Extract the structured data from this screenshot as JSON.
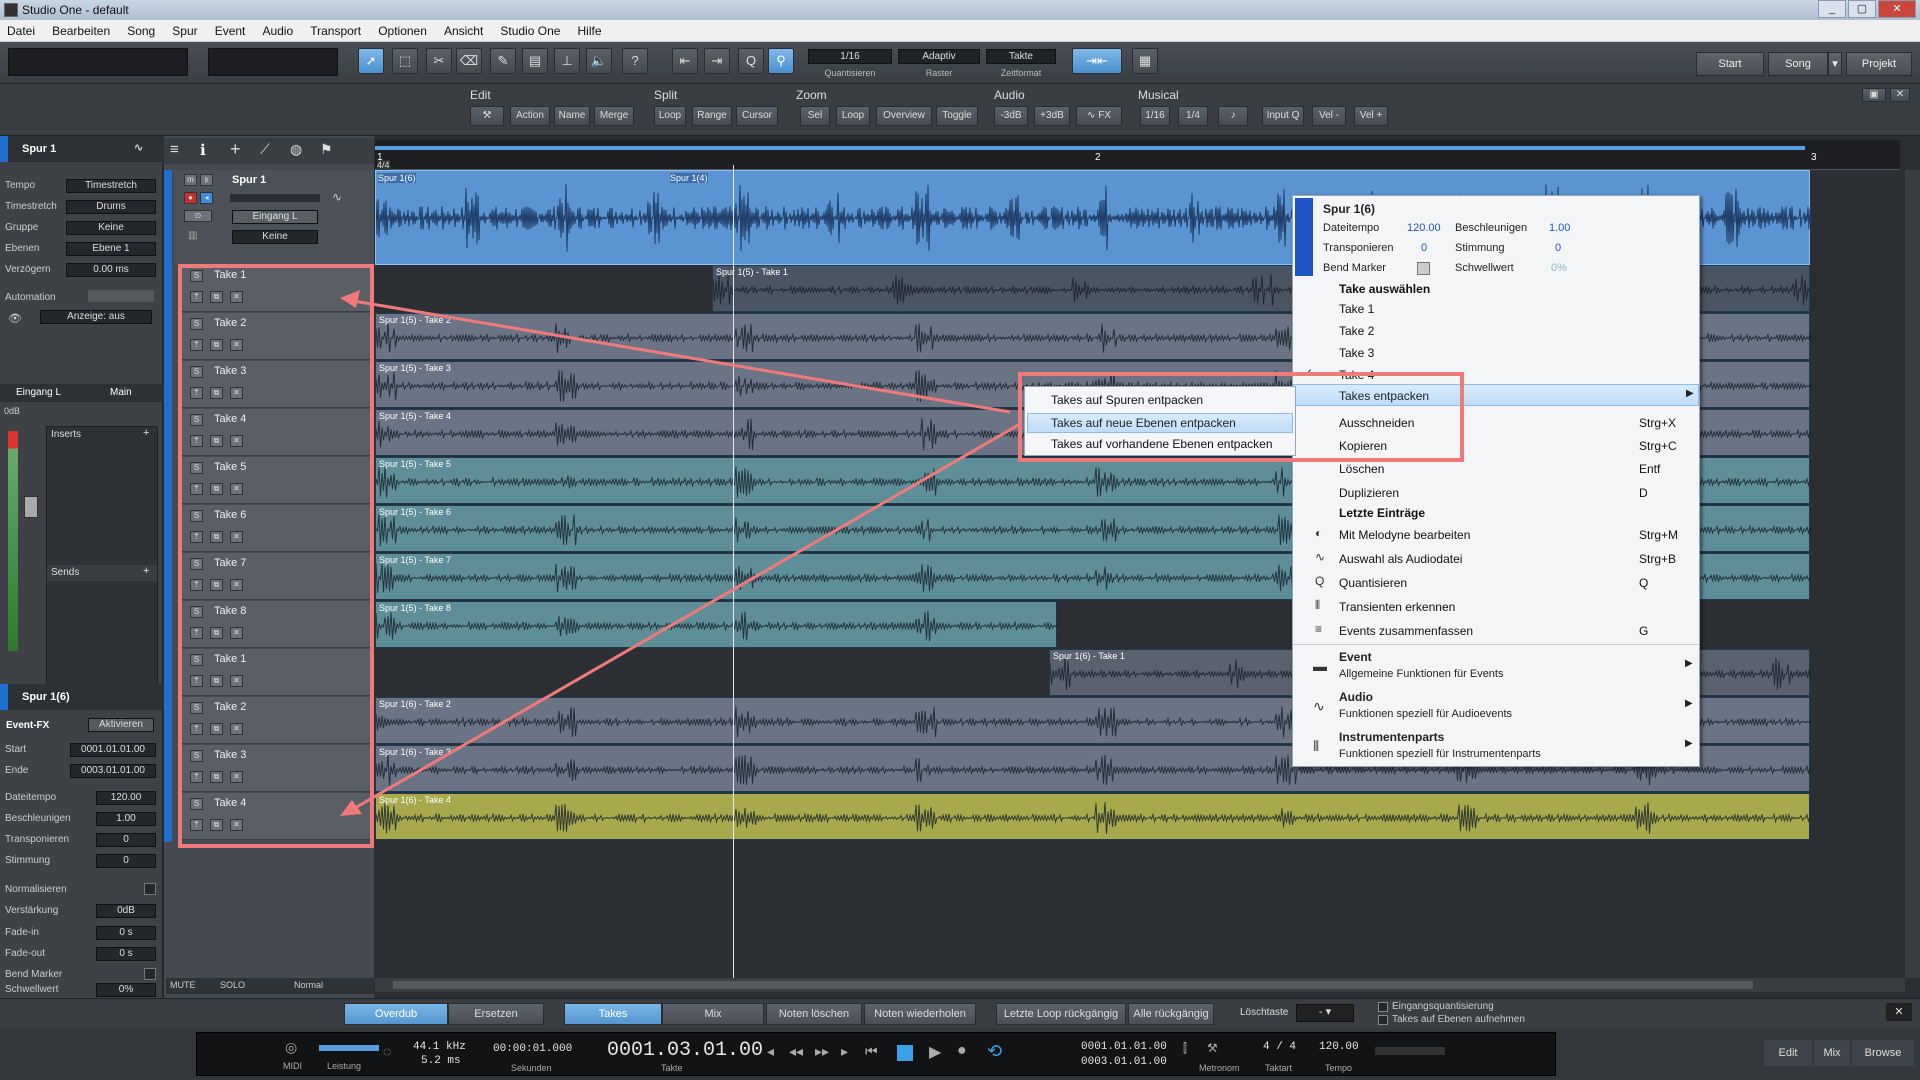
{
  "window": {
    "title": "Studio One - default",
    "buttons": [
      "_",
      "▢",
      "✕"
    ]
  },
  "menu": [
    "Datei",
    "Bearbeiten",
    "Song",
    "Spur",
    "Event",
    "Audio",
    "Transport",
    "Optionen",
    "Ansicht",
    "Studio One",
    "Hilfe"
  ],
  "toolbar": {
    "quantize_value": "1/16",
    "quantize_label": "Quantisieren",
    "snap_value": "Adaptiv",
    "snap_label": "Raster",
    "timebase_value": "Takte",
    "timebase_label": "Zeitformat",
    "start": "Start",
    "song": "Song",
    "projekt": "Projekt"
  },
  "edit_toolbar": {
    "groups": [
      {
        "name": "Edit",
        "buttons": [
          "Action",
          "Name",
          "Merge"
        ]
      },
      {
        "name": "Split",
        "buttons": [
          "Loop",
          "Range",
          "Cursor"
        ]
      },
      {
        "name": "Zoom",
        "buttons": [
          "Sel",
          "Loop",
          "Overview",
          "Toggle"
        ]
      },
      {
        "name": "Audio",
        "buttons": [
          "-3dB",
          "+3dB",
          "FX"
        ]
      },
      {
        "name": "Musical",
        "buttons": [
          "1/16",
          "1/4",
          "Input Q",
          "Vel -",
          "Vel +"
        ]
      }
    ]
  },
  "inspector": {
    "track_name": "Spur 1",
    "rows": [
      {
        "label": "Tempo",
        "value": "Timestretch"
      },
      {
        "label": "Timestretch",
        "value": "Drums"
      },
      {
        "label": "Gruppe",
        "value": "Keine"
      },
      {
        "label": "Ebenen",
        "value": "Ebene 1"
      },
      {
        "label": "Verzögern",
        "value": "0.00 ms"
      }
    ],
    "automation_label": "Automation",
    "automation_value": "Anzeige: aus",
    "input_label": "Eingang L",
    "output_label": "Main",
    "inserts": "Inserts",
    "sends": "Sends",
    "vol": "0dB",
    "event_name": "Spur 1(6)",
    "event_fx": "Event-FX",
    "activate": "Aktivieren",
    "event_rows": [
      {
        "label": "Start",
        "value": "0001.01.01.00"
      },
      {
        "label": "Ende",
        "value": "0003.01.01.00"
      },
      {
        "label": "Dateitempo",
        "value": "120.00"
      },
      {
        "label": "Beschleunigen",
        "value": "1.00"
      },
      {
        "label": "Transponieren",
        "value": "0"
      },
      {
        "label": "Stimmung",
        "value": "0"
      },
      {
        "label": "Normalisieren",
        "value": ""
      },
      {
        "label": "Verstärkung",
        "value": "0dB"
      },
      {
        "label": "Fade-in",
        "value": "0 s"
      },
      {
        "label": "Fade-out",
        "value": "0 s"
      },
      {
        "label": "Bend Marker",
        "value": ""
      },
      {
        "label": "Schwellwert",
        "value": "0%"
      }
    ],
    "mute_label": "MUTE",
    "solo_label": "SOLO",
    "mode_label": "Normal"
  },
  "main_track": {
    "name": "Spur 1",
    "input": "Eingang L",
    "layer": "Keine",
    "m": "m",
    "s": "s"
  },
  "takes": [
    "Take 1",
    "Take 2",
    "Take 3",
    "Take 4",
    "Take 5",
    "Take 6",
    "Take 7",
    "Take 8",
    "Take 1",
    "Take 2",
    "Take 3",
    "Take 4"
  ],
  "ruler": {
    "bars": [
      "1",
      "2",
      "3"
    ],
    "signature": "4/4"
  },
  "main_clips": [
    "Spur 1(6)",
    "Spur 1(4)"
  ],
  "lane_clips": [
    "Spur 1(5) - Take 1",
    "Spur 1(5) - Take 2",
    "Spur 1(5) - Take 3",
    "Spur 1(5) - Take 4",
    "Spur 1(5) - Take 5",
    "Spur 1(5) - Take 6",
    "Spur 1(5) - Take 7",
    "Spur 1(5) - Take 8",
    "Spur 1(6) - Take 1",
    "Spur 1(6) - Take 2",
    "Spur 1(6) - Take 3",
    "Spur 1(6) - Take 4"
  ],
  "context_menu": {
    "title": "Spur 1(6)",
    "info": [
      {
        "label": "Dateitempo",
        "value": "120.00"
      },
      {
        "label": "Beschleunigen",
        "value": "1.00"
      },
      {
        "label": "Transponieren",
        "value": "0"
      },
      {
        "label": "Stimmung",
        "value": "0"
      },
      {
        "label": "Bend Marker",
        "value": ""
      },
      {
        "label": "Schwellwert",
        "value": "0%"
      }
    ],
    "take_header": "Take auswählen",
    "take_items": [
      "Take 1",
      "Take 2",
      "Take 3",
      "Take 4"
    ],
    "items": [
      {
        "label": "Takes entpacken",
        "shortcut": ""
      },
      {
        "label": "Ausschneiden",
        "shortcut": "Strg+X"
      },
      {
        "label": "Kopieren",
        "shortcut": "Strg+C"
      },
      {
        "label": "Löschen",
        "shortcut": "Entf"
      },
      {
        "label": "Duplizieren",
        "shortcut": "D"
      }
    ],
    "recent_header": "Letzte Einträge",
    "recent": [
      {
        "label": "Mit Melodyne bearbeiten",
        "shortcut": "Strg+M"
      },
      {
        "label": "Auswahl als Audiodatei",
        "shortcut": "Strg+B"
      },
      {
        "label": "Quantisieren",
        "shortcut": "Q"
      },
      {
        "label": "Transienten erkennen",
        "shortcut": ""
      },
      {
        "label": "Events zusammenfassen",
        "shortcut": "G"
      }
    ],
    "categories": [
      {
        "title": "Event",
        "sub": "Allgemeine Funktionen für Events"
      },
      {
        "title": "Audio",
        "sub": "Funktionen speziell für Audioevents"
      },
      {
        "title": "Instrumentenparts",
        "sub": "Funktionen speziell für Instrumentenparts"
      }
    ]
  },
  "submenu": [
    "Takes auf Spuren entpacken",
    "Takes auf neue Ebenen entpacken",
    "Takes auf vorhandene Ebenen entpacken"
  ],
  "bottom_bar": {
    "buttons": [
      "Overdub",
      "Ersetzen",
      "Takes",
      "Mix",
      "Noten löschen",
      "Noten wiederholen",
      "Letzte Loop rückgängig",
      "Alle rückgängig"
    ],
    "loeschtaste": "Löschtaste",
    "check1": "Eingangsquantisierung",
    "check2": "Takes auf Ebenen aufnehmen"
  },
  "transport": {
    "midi": "MIDI",
    "leistung": "Leistung",
    "sample_rate": "44.1 kHz",
    "latency": "5.2 ms",
    "seconds": "00:00:01.000",
    "seconds_label": "Sekunden",
    "position": "0001.03.01.00",
    "position_label": "Takte",
    "loop_start": "0001.01.01.00",
    "loop_end": "0003.01.01.00",
    "metronom": "Metronom",
    "signature": "4 / 4",
    "signature_label": "Taktart",
    "tempo": "120.00",
    "tempo_label": "Tempo",
    "views": [
      "Edit",
      "Mix",
      "Browse"
    ]
  }
}
